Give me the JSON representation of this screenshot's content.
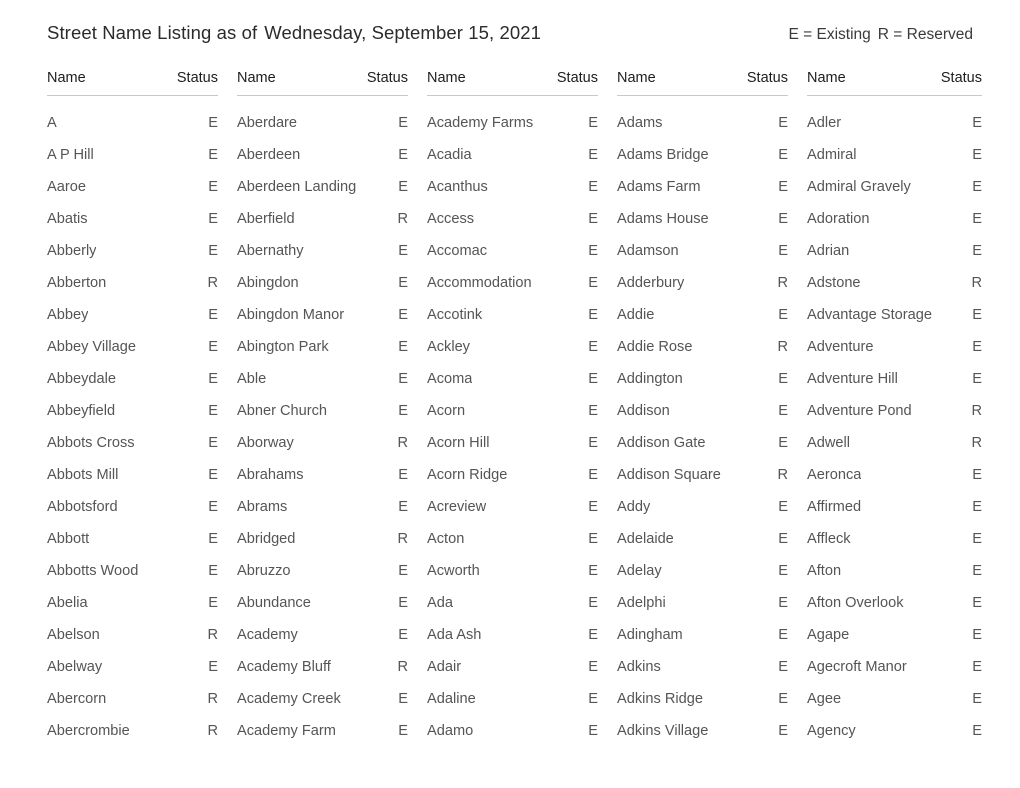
{
  "header": {
    "title_prefix": "Street Name Listing as of",
    "title_date": "Wednesday, September 15, 2021",
    "legend_existing": "E = Existing",
    "legend_reserved": "R = Reserved"
  },
  "table": {
    "column_headers": {
      "name": "Name",
      "status": "Status"
    },
    "status_codes": {
      "existing": "E",
      "reserved": "R"
    },
    "columns": [
      {
        "index": 1,
        "rows": [
          {
            "name": "A",
            "status": "E"
          },
          {
            "name": "A P Hill",
            "status": "E"
          },
          {
            "name": "Aaroe",
            "status": "E"
          },
          {
            "name": "Abatis",
            "status": "E"
          },
          {
            "name": "Abberly",
            "status": "E"
          },
          {
            "name": "Abberton",
            "status": "R"
          },
          {
            "name": "Abbey",
            "status": "E"
          },
          {
            "name": "Abbey Village",
            "status": "E"
          },
          {
            "name": "Abbeydale",
            "status": "E"
          },
          {
            "name": "Abbeyfield",
            "status": "E"
          },
          {
            "name": "Abbots Cross",
            "status": "E"
          },
          {
            "name": "Abbots Mill",
            "status": "E"
          },
          {
            "name": "Abbotsford",
            "status": "E"
          },
          {
            "name": "Abbott",
            "status": "E"
          },
          {
            "name": "Abbotts Wood",
            "status": "E"
          },
          {
            "name": "Abelia",
            "status": "E"
          },
          {
            "name": "Abelson",
            "status": "R"
          },
          {
            "name": "Abelway",
            "status": "E"
          },
          {
            "name": "Abercorn",
            "status": "R"
          },
          {
            "name": "Abercrombie",
            "status": "R"
          }
        ]
      },
      {
        "index": 2,
        "rows": [
          {
            "name": "Aberdare",
            "status": "E"
          },
          {
            "name": "Aberdeen",
            "status": "E"
          },
          {
            "name": "Aberdeen Landing",
            "status": "E"
          },
          {
            "name": "Aberfield",
            "status": "R"
          },
          {
            "name": "Abernathy",
            "status": "E"
          },
          {
            "name": "Abingdon",
            "status": "E"
          },
          {
            "name": "Abingdon Manor",
            "status": "E"
          },
          {
            "name": "Abington Park",
            "status": "E"
          },
          {
            "name": "Able",
            "status": "E"
          },
          {
            "name": "Abner Church",
            "status": "E"
          },
          {
            "name": "Aborway",
            "status": "R"
          },
          {
            "name": "Abrahams",
            "status": "E"
          },
          {
            "name": "Abrams",
            "status": "E"
          },
          {
            "name": "Abridged",
            "status": "R"
          },
          {
            "name": "Abruzzo",
            "status": "E"
          },
          {
            "name": "Abundance",
            "status": "E"
          },
          {
            "name": "Academy",
            "status": "E"
          },
          {
            "name": "Academy Bluff",
            "status": "R"
          },
          {
            "name": "Academy Creek",
            "status": "E"
          },
          {
            "name": "Academy Farm",
            "status": "E"
          }
        ]
      },
      {
        "index": 3,
        "rows": [
          {
            "name": "Academy Farms",
            "status": "E"
          },
          {
            "name": "Acadia",
            "status": "E"
          },
          {
            "name": "Acanthus",
            "status": "E"
          },
          {
            "name": "Access",
            "status": "E"
          },
          {
            "name": "Accomac",
            "status": "E"
          },
          {
            "name": "Accommodation",
            "status": "E"
          },
          {
            "name": "Accotink",
            "status": "E"
          },
          {
            "name": "Ackley",
            "status": "E"
          },
          {
            "name": "Acoma",
            "status": "E"
          },
          {
            "name": "Acorn",
            "status": "E"
          },
          {
            "name": "Acorn Hill",
            "status": "E"
          },
          {
            "name": "Acorn Ridge",
            "status": "E"
          },
          {
            "name": "Acreview",
            "status": "E"
          },
          {
            "name": "Acton",
            "status": "E"
          },
          {
            "name": "Acworth",
            "status": "E"
          },
          {
            "name": "Ada",
            "status": "E"
          },
          {
            "name": "Ada Ash",
            "status": "E"
          },
          {
            "name": "Adair",
            "status": "E"
          },
          {
            "name": "Adaline",
            "status": "E"
          },
          {
            "name": "Adamo",
            "status": "E"
          }
        ]
      },
      {
        "index": 4,
        "rows": [
          {
            "name": "Adams",
            "status": "E"
          },
          {
            "name": "Adams Bridge",
            "status": "E"
          },
          {
            "name": "Adams Farm",
            "status": "E"
          },
          {
            "name": "Adams House",
            "status": "E"
          },
          {
            "name": "Adamson",
            "status": "E"
          },
          {
            "name": "Adderbury",
            "status": "R"
          },
          {
            "name": "Addie",
            "status": "E"
          },
          {
            "name": "Addie Rose",
            "status": "R"
          },
          {
            "name": "Addington",
            "status": "E"
          },
          {
            "name": "Addison",
            "status": "E"
          },
          {
            "name": "Addison Gate",
            "status": "E"
          },
          {
            "name": "Addison Square",
            "status": "R"
          },
          {
            "name": "Addy",
            "status": "E"
          },
          {
            "name": "Adelaide",
            "status": "E"
          },
          {
            "name": "Adelay",
            "status": "E"
          },
          {
            "name": "Adelphi",
            "status": "E"
          },
          {
            "name": "Adingham",
            "status": "E"
          },
          {
            "name": "Adkins",
            "status": "E"
          },
          {
            "name": "Adkins Ridge",
            "status": "E"
          },
          {
            "name": "Adkins Village",
            "status": "E"
          }
        ]
      },
      {
        "index": 5,
        "rows": [
          {
            "name": "Adler",
            "status": "E"
          },
          {
            "name": "Admiral",
            "status": "E"
          },
          {
            "name": "Admiral Gravely",
            "status": "E"
          },
          {
            "name": "Adoration",
            "status": "E"
          },
          {
            "name": "Adrian",
            "status": "E"
          },
          {
            "name": "Adstone",
            "status": "R"
          },
          {
            "name": "Advantage Storage",
            "status": "E"
          },
          {
            "name": "Adventure",
            "status": "E"
          },
          {
            "name": "Adventure Hill",
            "status": "E"
          },
          {
            "name": "Adventure Pond",
            "status": "R"
          },
          {
            "name": "Adwell",
            "status": "R"
          },
          {
            "name": "Aeronca",
            "status": "E"
          },
          {
            "name": "Affirmed",
            "status": "E"
          },
          {
            "name": "Affleck",
            "status": "E"
          },
          {
            "name": "Afton",
            "status": "E"
          },
          {
            "name": "Afton Overlook",
            "status": "E"
          },
          {
            "name": "Agape",
            "status": "E"
          },
          {
            "name": "Agecroft Manor",
            "status": "E"
          },
          {
            "name": "Agee",
            "status": "E"
          },
          {
            "name": "Agency",
            "status": "E"
          }
        ]
      }
    ]
  }
}
